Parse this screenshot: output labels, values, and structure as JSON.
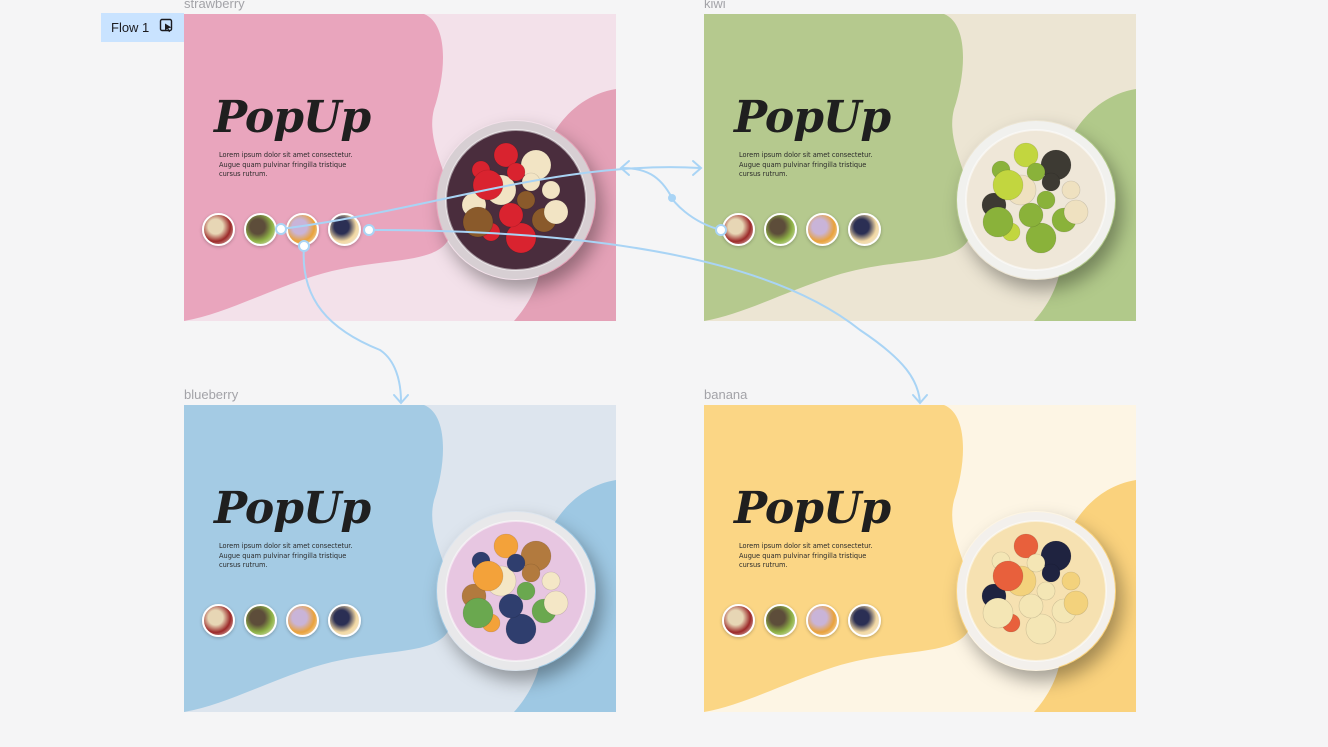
{
  "flow": {
    "label": "Flow 1",
    "icon": "play-frame-icon"
  },
  "frames": [
    {
      "id": "strawberry",
      "name": "strawberry",
      "colors": {
        "blob": "#e9a5bd",
        "bg": "#f3e1ea",
        "accent": "#e4a1b7",
        "bowl": "#d7cfd3"
      },
      "logo": "PopUp",
      "description": [
        "Lorem ipsum dolor sit amet consectetur.",
        "Augue quam pulvinar fringilla tristique",
        "cursus rutrum."
      ],
      "food": "strawberry-banana-acai-bowl"
    },
    {
      "id": "kiwi",
      "name": "kiwi",
      "colors": {
        "blob": "#b5c98e",
        "bg": "#ece5d3",
        "accent": "#b1c98a",
        "bowl": "#f1f1ee"
      },
      "logo": "PopUp",
      "description": [
        "Lorem ipsum dolor sit amet consectetur.",
        "Augue quam pulvinar fringilla tristique",
        "cursus rutrum."
      ],
      "food": "kiwi-chia-yogurt-bowl"
    },
    {
      "id": "blueberry",
      "name": "blueberry",
      "colors": {
        "blob": "#a4cbe4",
        "bg": "#dde5ee",
        "accent": "#9ec8e3",
        "bowl": "#e8e8ea"
      },
      "logo": "PopUp",
      "description": [
        "Lorem ipsum dolor sit amet consectetur.",
        "Augue quam pulvinar fringilla tristique",
        "cursus rutrum."
      ],
      "food": "blueberry-yogurt-granola-bowl"
    },
    {
      "id": "banana",
      "name": "banana",
      "colors": {
        "blob": "#fbd685",
        "bg": "#fdf5e4",
        "accent": "#fad27d",
        "bowl": "#f3f0ec"
      },
      "logo": "PopUp",
      "description": [
        "Lorem ipsum dolor sit amet consectetur.",
        "Augue quam pulvinar fringilla tristique",
        "cursus rutrum."
      ],
      "food": "mixed-fruit-salad-bowl"
    }
  ],
  "thumbnails": [
    {
      "name": "strawberry",
      "c1": "#9c2a2a",
      "c2": "#e7d6b5"
    },
    {
      "name": "kiwi",
      "c1": "#8fb347",
      "c2": "#5d4d3a"
    },
    {
      "name": "blueberry",
      "c1": "#e9a23c",
      "c2": "#c9b4d8"
    },
    {
      "name": "banana",
      "c1": "#f2d8a3",
      "c2": "#2b2f54"
    }
  ],
  "connector_color": "#a9d4f5"
}
